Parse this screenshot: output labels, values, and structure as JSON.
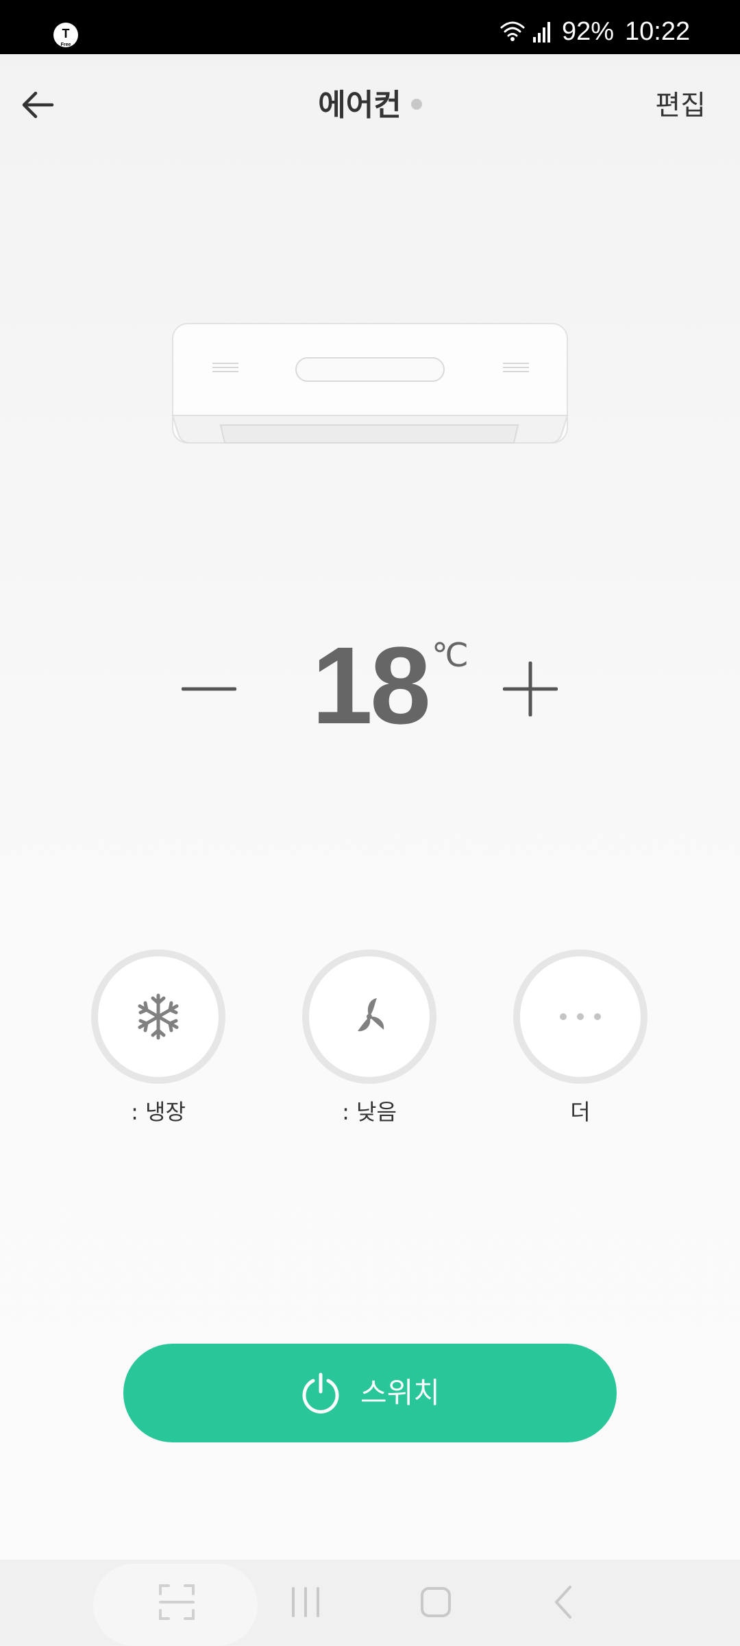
{
  "status_bar": {
    "carrier_logo": "T",
    "carrier_logo_sub": "Free",
    "icons": [
      "wifi-icon",
      "signal-icon"
    ],
    "battery": "92%",
    "time": "10:22"
  },
  "header": {
    "back_icon": "arrow-left-icon",
    "title": "에어컨",
    "edit_label": "편집"
  },
  "temperature": {
    "value": "18",
    "unit": "℃"
  },
  "modes": [
    {
      "icon": "snowflake-icon",
      "label": ": 냉장"
    },
    {
      "icon": "fan-icon",
      "label": ": 낮음"
    },
    {
      "icon": "more-icon",
      "label": "더"
    }
  ],
  "power": {
    "icon": "power-icon",
    "label": "스위치",
    "color": "#29c69a"
  },
  "colors": {
    "accent": "#29c69a",
    "status_dot": "#c8c8c8"
  },
  "nav_bar": {
    "icons": [
      "scan-icon",
      "recent-apps-icon",
      "home-icon",
      "back-icon"
    ]
  }
}
